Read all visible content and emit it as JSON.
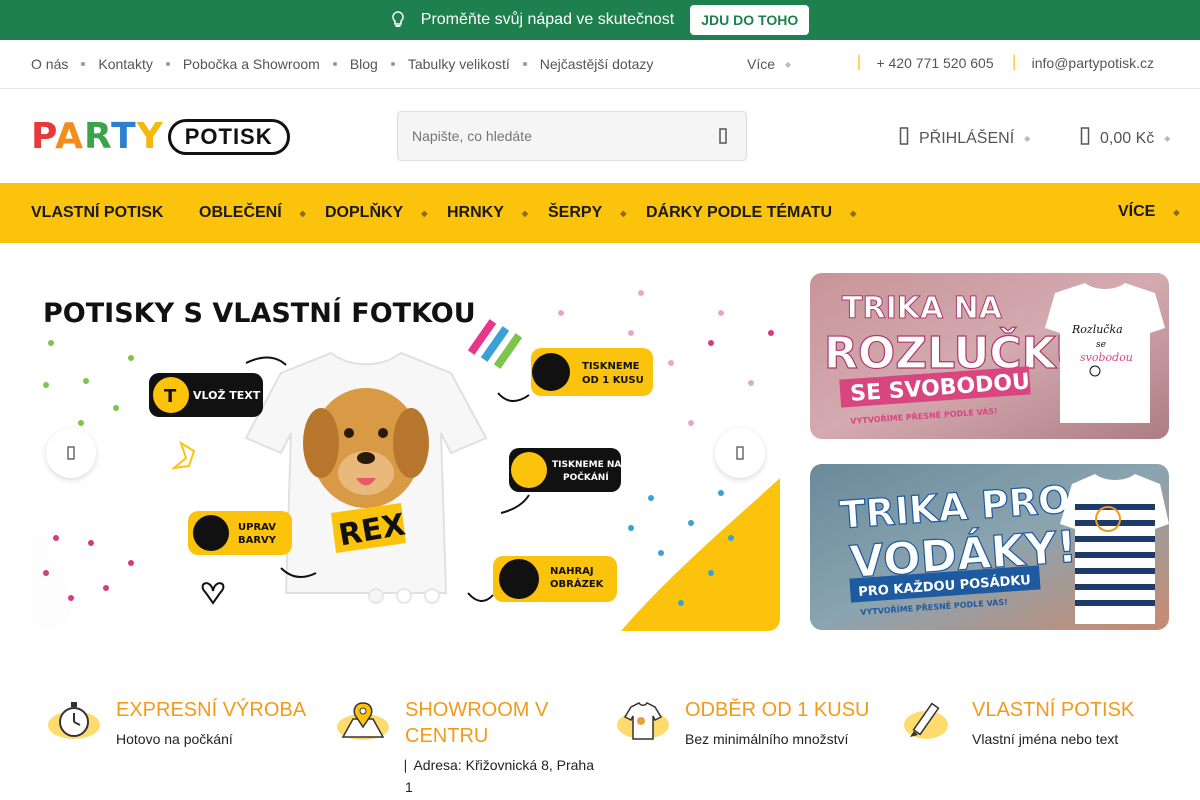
{
  "promo": {
    "text": "Proměňte svůj nápad ve skutečnost",
    "cta": "JDU DO TOHO"
  },
  "subnav": {
    "links": [
      "O nás",
      "Kontakty",
      "Pobočka a Showroom",
      "Blog",
      "Tabulky velikostí",
      "Nejčastější dotazy"
    ],
    "more": "Více",
    "phone": "+ 420 771 520 605",
    "email": "info@partypotisk.cz"
  },
  "header": {
    "logo_party": "PARTY",
    "logo_potisk": "POTISK",
    "search_placeholder": "Napište, co hledáte",
    "login": "PŘIHLÁŠENÍ",
    "cart": "0,00 Kč"
  },
  "mainnav": {
    "items": [
      "VLASTNÍ POTISK",
      "OBLEČENÍ",
      "DOPLŇKY",
      "HRNKY",
      "ŠERPY",
      "DÁRKY PODLE TÉMATU"
    ],
    "more": "VÍCE"
  },
  "hero": {
    "headline": "POTISKY S VLASTNÍ FOTKOU",
    "badges": {
      "text": "VLOŽ TEXT",
      "print1": "TISKNEME",
      "print2": "OD 1 KUSU",
      "wait1": "TISKNEME NA",
      "wait2": "POČKÁNÍ",
      "colors1": "UPRAV",
      "colors2": "BARVY",
      "image1": "NAHRAJ",
      "image2": "OBRÁZEK"
    },
    "shirt_text": "REX",
    "slides": 3,
    "active_slide": 1
  },
  "banners": [
    {
      "line1": "TRIKA NA",
      "line2": "ROZLUČKU",
      "line3": "SE SVOBODOU",
      "sub": "VYTVOŘÍME PŘESNĚ PODLE VÁS!",
      "shirt": "Rozlučka se svobodou"
    },
    {
      "line1": "TRIKA PRO",
      "line2": "VODÁKY!!!",
      "line3": "PRO KAŽDOU POSÁDKU",
      "sub": "VYTVOŘÍME PŘESNĚ PODLE VÁS!"
    }
  ],
  "features": [
    {
      "title": "EXPRESNÍ VÝROBA",
      "text": "Hotovo na počkání",
      "icon": "stopwatch-icon"
    },
    {
      "title": "SHOWROOM V CENTRU",
      "text": "Adresa: Křižovnická 8, Praha 1",
      "icon": "map-pin-icon"
    },
    {
      "title": "ODBĚR OD 1 KUSU",
      "text": "Bez minimálního množství",
      "icon": "tshirt-icon"
    },
    {
      "title": "VLASTNÍ POTISK",
      "text": "Vlastní jména nebo text",
      "icon": "pencil-icon"
    }
  ],
  "colors": {
    "promo_green": "#1e7f4f",
    "nav_yellow": "#fcc30c",
    "feature_orange": "#f29a1a"
  }
}
